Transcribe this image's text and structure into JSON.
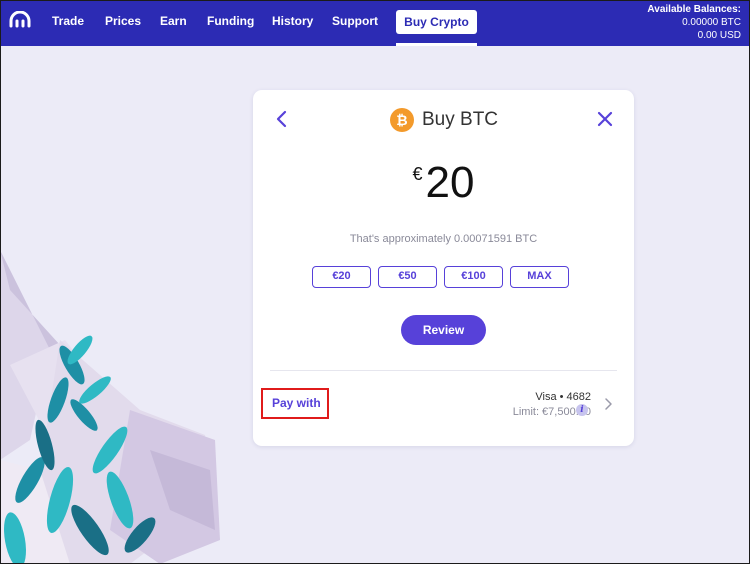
{
  "nav": {
    "items": [
      "Trade",
      "Prices",
      "Earn",
      "Funding",
      "History",
      "Support"
    ],
    "active": "Buy Crypto"
  },
  "balances": {
    "title": "Available Balances:",
    "btc": "0.00000 BTC",
    "usd": "0.00 USD"
  },
  "card": {
    "title": "Buy BTC",
    "coin_symbol": "₿",
    "currency_symbol": "€",
    "amount": "20",
    "approx_text": "That's approximately 0.00071591 BTC",
    "presets": [
      "€20",
      "€50",
      "€100",
      "MAX"
    ],
    "review_label": "Review",
    "pay_with_label": "Pay with",
    "payment_card": "Visa • 4682",
    "limit": "Limit: €7,500.00",
    "info_glyph": "i"
  },
  "colors": {
    "nav_bg": "#2c2bb4",
    "accent": "#5741d9",
    "bitcoin": "#f39a2b",
    "page_bg": "#ecebf7"
  }
}
